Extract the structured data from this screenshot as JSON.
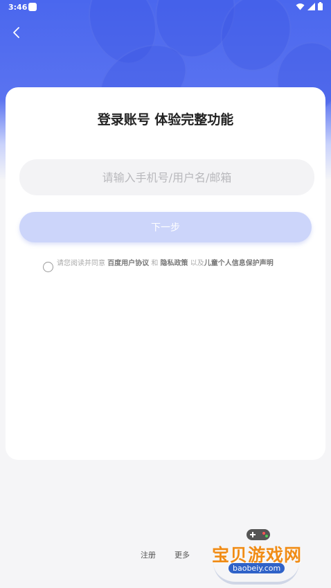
{
  "status_bar": {
    "time": "3:46"
  },
  "login": {
    "title": "登录账号 体验完整功能",
    "input_placeholder": "请输入手机号/用户名/邮箱",
    "next_label": "下一步",
    "agreement": {
      "prefix": "请您阅读并同意 ",
      "user_agreement": "百度用户协议",
      "and": " 和 ",
      "privacy_policy": "隐私政策",
      "and2": " 以及",
      "child_policy": "儿童个人信息保护声明"
    }
  },
  "footer": {
    "register": "注册",
    "more": "更多"
  },
  "watermark": {
    "brand": "宝贝游戏网",
    "url": "baobeiy.com"
  },
  "colors": {
    "primary": "#4a67ee",
    "button_disabled": "#ccd5fa",
    "watermark": "#f08c16"
  }
}
